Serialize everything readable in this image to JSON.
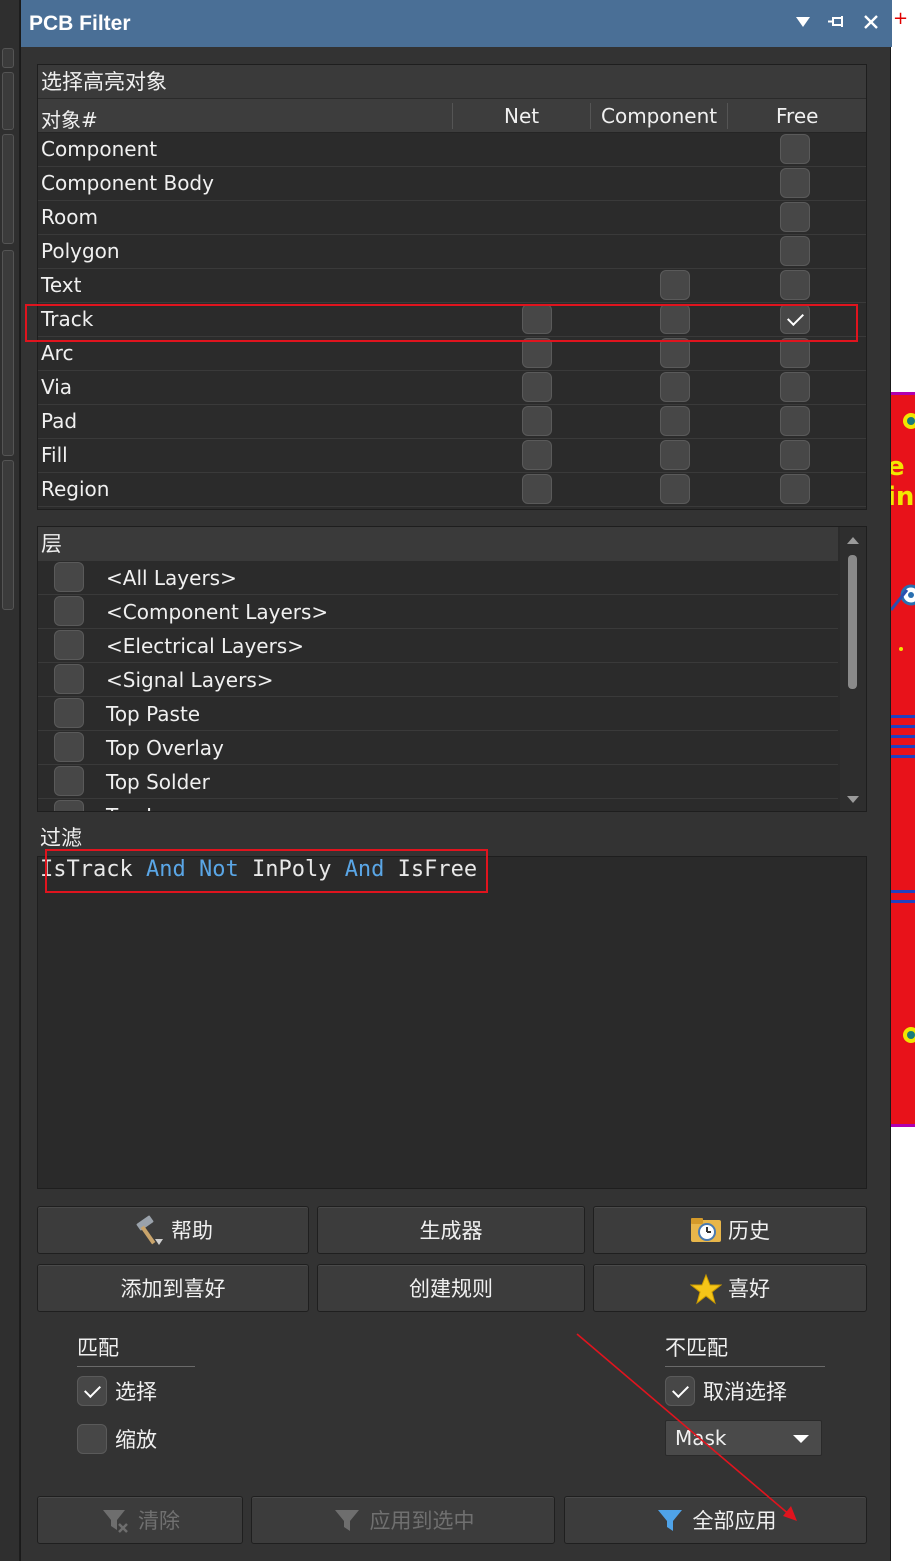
{
  "window": {
    "title": "PCB Filter"
  },
  "objects": {
    "caption": "选择高亮对象",
    "columns": {
      "name": "对象#",
      "net": "Net",
      "component": "Component",
      "free": "Free"
    },
    "rows": [
      {
        "label": "Component",
        "net": null,
        "component": null,
        "free": false
      },
      {
        "label": "Component Body",
        "net": null,
        "component": null,
        "free": false
      },
      {
        "label": "Room",
        "net": null,
        "component": null,
        "free": false
      },
      {
        "label": "Polygon",
        "net": null,
        "component": null,
        "free": false
      },
      {
        "label": "Text",
        "net": null,
        "component": false,
        "free": false
      },
      {
        "label": "Track",
        "net": false,
        "component": false,
        "free": true
      },
      {
        "label": "Arc",
        "net": false,
        "component": false,
        "free": false
      },
      {
        "label": "Via",
        "net": false,
        "component": false,
        "free": false
      },
      {
        "label": "Pad",
        "net": false,
        "component": false,
        "free": false
      },
      {
        "label": "Fill",
        "net": false,
        "component": false,
        "free": false
      },
      {
        "label": "Region",
        "net": false,
        "component": false,
        "free": false
      }
    ]
  },
  "layers": {
    "caption": "层",
    "items": [
      {
        "label": "<All Layers>",
        "checked": false
      },
      {
        "label": "<Component Layers>",
        "checked": false
      },
      {
        "label": "<Electrical Layers>",
        "checked": false
      },
      {
        "label": "<Signal Layers>",
        "checked": false
      },
      {
        "label": "Top Paste",
        "checked": false
      },
      {
        "label": "Top Overlay",
        "checked": false
      },
      {
        "label": "Top Solder",
        "checked": false
      },
      {
        "label": "Top Layer",
        "checked": false
      }
    ]
  },
  "filter": {
    "label": "过滤",
    "tokens": [
      {
        "text": "IsTrack ",
        "keyword": false
      },
      {
        "text": "And",
        "keyword": true
      },
      {
        "text": " ",
        "keyword": false
      },
      {
        "text": "Not",
        "keyword": true
      },
      {
        "text": " InPoly ",
        "keyword": false
      },
      {
        "text": "And",
        "keyword": true
      },
      {
        "text": " IsFree",
        "keyword": false
      }
    ]
  },
  "buttons": {
    "help": "帮助",
    "builder": "生成器",
    "history": "历史",
    "add_favorite": "添加到喜好",
    "create_rule": "创建规则",
    "favorites": "喜好",
    "clear": "清除",
    "apply_selected": "应用到选中",
    "apply_all": "全部应用"
  },
  "match": {
    "title": "匹配",
    "select": {
      "label": "选择",
      "checked": true
    },
    "zoom": {
      "label": "缩放",
      "checked": false
    }
  },
  "nonmatch": {
    "title": "不匹配",
    "deselect": {
      "label": "取消选择",
      "checked": true
    },
    "mode": "Mask"
  },
  "colors": {
    "titlebar": "#4a6f96",
    "keyword": "#5aa6e6",
    "annotation": "#e0141e",
    "pcb_board": "#e8121a"
  }
}
